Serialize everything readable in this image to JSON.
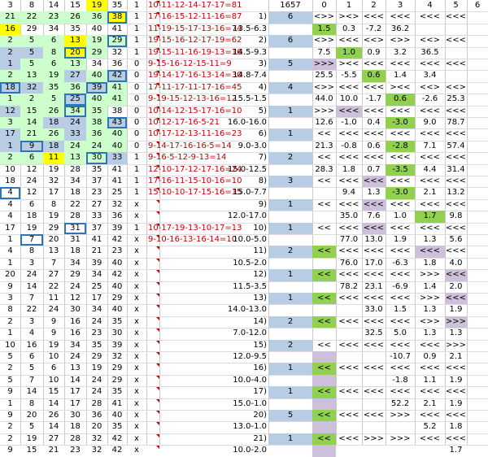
{
  "header": {
    "cols": [
      "3",
      "8",
      "14",
      "15",
      "19",
      "35",
      "1",
      "10-11-12-14-17-17=81",
      "",
      "1657",
      "0",
      "1",
      "2",
      "3",
      "4",
      "5",
      "6"
    ]
  },
  "colors": {
    "green": "#ccffcc",
    "blue": "#b8cce4",
    "yellow": "#ffff00",
    "darkgreen": "#92d050",
    "purple": "#ccc0da",
    "box": "#2e75b6",
    "red": "#c00000"
  },
  "rows": [
    {
      "n": [
        "21",
        "22",
        "23",
        "26",
        "36",
        "38"
      ],
      "d": "1",
      "eq": "17-16-15-12-11-16=87",
      "lbl": "1)",
      "s": "6",
      "r": [
        "<>>",
        "><>",
        "<<<",
        "<<<",
        "<<<",
        "<<<"
      ],
      "bg": [
        "g",
        "g",
        "g",
        "g",
        "g",
        "y"
      ]
    },
    {
      "n": [
        "16",
        "29",
        "34",
        "35",
        "40",
        "41"
      ],
      "d": "1",
      "eq": "11-19-15-17-13-16=74",
      "lbl": "13.5-6.3",
      "s": "",
      "r": [
        "1.5",
        "0.3",
        "-7.2",
        "36.2",
        "",
        ""
      ],
      "bg": [
        "y",
        "",
        "",
        "",
        "",
        ""
      ]
    },
    {
      "n": [
        "2",
        "5",
        "6",
        "13",
        "19",
        "29"
      ],
      "d": "1",
      "eq": "19-15-16-12-17-19=62",
      "lbl": "2)",
      "s": "6",
      "r": [
        "<>>",
        "<<<",
        "<<>",
        "<>>",
        "<<>",
        "<<<"
      ],
      "bg": [
        "g",
        "g",
        "g",
        "y",
        "g",
        "g"
      ]
    },
    {
      "n": [
        "2",
        "5",
        "8",
        "20",
        "29",
        "32"
      ],
      "d": "1",
      "eq": "19-15-11-16-19-13=16",
      "lbl": "14.5-9.3",
      "s": "",
      "r": [
        "7.5",
        "1.0",
        "0.9",
        "3.2",
        "36.5",
        ""
      ],
      "bg": [
        "b",
        "b",
        "g",
        "y",
        "g",
        ""
      ]
    },
    {
      "n": [
        "1",
        "5",
        "6",
        "13",
        "34",
        "36"
      ],
      "d": "0",
      "eq": "9-15-16-12-15-11=9",
      "lbl": "3)",
      "s": "5",
      "r": [
        ">>>",
        "><<",
        "<<<",
        "<<<",
        "<<<",
        "<<<"
      ],
      "bg": [
        "b",
        "g",
        "g",
        "g",
        "",
        ""
      ]
    },
    {
      "n": [
        "2",
        "13",
        "19",
        "27",
        "40",
        "42"
      ],
      "d": "0",
      "eq": "19-14-17-16-13-14=30",
      "lbl": "14.8-7.4",
      "s": "",
      "r": [
        "25.5",
        "-5.5",
        "0.6",
        "1.4",
        "3.4",
        ""
      ],
      "bg": [
        "g",
        "g",
        "g",
        "b",
        "g",
        "b"
      ]
    },
    {
      "n": [
        "18",
        "32",
        "35",
        "36",
        "39",
        "41"
      ],
      "d": "0",
      "eq": "17-11-17-11-17-16=45",
      "lbl": "4)",
      "s": "4",
      "r": [
        "<>>",
        "<<<",
        "<<<",
        "><<",
        "<<>",
        "<<>"
      ],
      "bg": [
        "b",
        "b",
        "g",
        "g",
        "b",
        "g"
      ]
    },
    {
      "n": [
        "1",
        "2",
        "5",
        "25",
        "40",
        "41"
      ],
      "d": "0",
      "eq": "9-19-15-12-13-16=12",
      "lbl": "15.5-1.5",
      "s": "",
      "r": [
        "44.0",
        "10.0",
        "-1.7",
        "0.6",
        "-2.6",
        "25.3"
      ],
      "bg": [
        "g",
        "g",
        "g",
        "b",
        "g",
        "g"
      ]
    },
    {
      "n": [
        "12",
        "15",
        "26",
        "34",
        "35",
        "38"
      ],
      "d": "0",
      "eq": "10-14-12-15-17-16=10",
      "lbl": "5)",
      "s": "1",
      "r": [
        ">>>",
        "<<<",
        "<<<",
        "<<<",
        "<<<",
        "<<<"
      ],
      "bg": [
        "b",
        "g",
        "g",
        "g",
        "g",
        ""
      ]
    },
    {
      "n": [
        "3",
        "14",
        "18",
        "24",
        "38",
        "43"
      ],
      "d": "0",
      "eq": "10-12-17-16-5-21",
      "lbl": "16.0-16.0",
      "s": "",
      "r": [
        "12.6",
        "-1.0",
        "0.4",
        "-3.0",
        "9.0",
        "78.7"
      ],
      "bg": [
        "g",
        "g",
        "b",
        "b",
        "g",
        "b"
      ]
    },
    {
      "n": [
        "17",
        "21",
        "26",
        "33",
        "36",
        "40"
      ],
      "d": "0",
      "eq": "10-17-12-13-11-16=23",
      "lbl": "6)",
      "s": "1",
      "r": [
        "<<",
        "<<<",
        "<<<",
        "<<<",
        "<<<",
        "<<<"
      ],
      "bg": [
        "b",
        "g",
        "g",
        "b",
        "g",
        "g"
      ]
    },
    {
      "n": [
        "1",
        "9",
        "18",
        "24",
        "24",
        "40"
      ],
      "d": "0",
      "eq": "9-14-17-16-16-5=14",
      "lbl": "9.0-3.0",
      "s": "",
      "r": [
        "21.3",
        "-0.8",
        "0.6",
        "-2.8",
        "7.1",
        "57.4"
      ],
      "bg": [
        "b",
        "b",
        "b",
        "g",
        "g",
        "g"
      ]
    },
    {
      "n": [
        "2",
        "6",
        "11",
        "13",
        "30",
        "33"
      ],
      "d": "1",
      "eq": "9-16-5-12-9-13=14",
      "lbl": "7)",
      "s": "2",
      "r": [
        "<<",
        "<<<",
        "<<<",
        "<<<",
        "<<<",
        "<<<"
      ],
      "bg": [
        "g",
        "g",
        "y",
        "g",
        "g",
        "b"
      ]
    },
    {
      "n": [
        "10",
        "12",
        "19",
        "28",
        "35",
        "41"
      ],
      "d": "1",
      "eq": "12-10-17-12-17-16=24",
      "lbl": "15.0-12.5",
      "s": "",
      "r": [
        "28.3",
        "1.8",
        "0.7",
        "-3.5",
        "4.4",
        "31.4"
      ],
      "bg": [
        "",
        "",
        "",
        "",
        "",
        ""
      ]
    },
    {
      "n": [
        "18",
        "24",
        "32",
        "34",
        "37",
        "41"
      ],
      "d": "1",
      "eq": "17-16-11-15-10-16=10",
      "lbl": "8)",
      "s": "3",
      "r": [
        "<<",
        "<<<",
        "<<<",
        "<<<",
        "<<<",
        "<<<"
      ],
      "bg": [
        "",
        "",
        "",
        "",
        "",
        ""
      ]
    },
    {
      "n": [
        "4",
        "12",
        "17",
        "18",
        "23",
        "25"
      ],
      "d": "1",
      "eq": "15-10-10-17-15-16=15",
      "lbl": "15.0-7.7",
      "s": "",
      "r": [
        "",
        "9.4",
        "1.3",
        "-3.0",
        "2.1",
        "13.2"
      ],
      "bg": [
        "",
        "",
        "",
        "",
        "",
        ""
      ]
    },
    {
      "n": [
        "4",
        "6",
        "8",
        "22",
        "27",
        "32"
      ],
      "d": "x",
      "eq": "",
      "lbl": "9)",
      "s": "1",
      "r": [
        "<<",
        "<<<",
        "<<<",
        "<<<",
        "<<<",
        "<<<"
      ],
      "bg": [
        "",
        "",
        "",
        "",
        "",
        ""
      ]
    },
    {
      "n": [
        "4",
        "18",
        "19",
        "28",
        "33",
        "36"
      ],
      "d": "x",
      "eq": "",
      "lbl": "12.0-17.0",
      "s": "",
      "r": [
        "",
        "35.0",
        "7.6",
        "1.0",
        "1.7",
        "9.8"
      ],
      "bg": [
        "",
        "",
        "",
        "",
        "",
        ""
      ]
    },
    {
      "n": [
        "17",
        "19",
        "29",
        "31",
        "37",
        "39"
      ],
      "d": "1",
      "eq": "10-17-19-13-10-17=13",
      "lbl": "10)",
      "s": "1",
      "r": [
        "<<",
        "<<<",
        "<<<",
        "<<<",
        "<<<",
        "<<<"
      ],
      "bg": [
        "",
        "",
        "",
        "",
        "",
        ""
      ]
    },
    {
      "n": [
        "1",
        "7",
        "20",
        "31",
        "41",
        "42"
      ],
      "d": "x",
      "eq": "9-10-16-13-16-14=10",
      "lbl": "10.0-5.0",
      "s": "",
      "r": [
        "",
        "77.0",
        "13.0",
        "1.9",
        "1.3",
        "5.6"
      ],
      "bg": [
        "",
        "",
        "",
        "",
        "",
        ""
      ]
    },
    {
      "n": [
        "4",
        "8",
        "13",
        "18",
        "21",
        "23"
      ],
      "d": "x",
      "eq": "",
      "lbl": "11)",
      "s": "2",
      "r": [
        "<<",
        "<<<",
        "<<<",
        "<<<",
        "<<<",
        "<<<"
      ],
      "bg": [
        "",
        "",
        "",
        "",
        "",
        ""
      ]
    },
    {
      "n": [
        "1",
        "3",
        "7",
        "34",
        "39",
        "40"
      ],
      "d": "x",
      "eq": "",
      "lbl": "10.5-2.0",
      "s": "",
      "r": [
        "",
        "76.0",
        "17.0",
        "-6.3",
        "1.8",
        "4.0"
      ],
      "bg": [
        "",
        "",
        "",
        "",
        "",
        ""
      ]
    },
    {
      "n": [
        "20",
        "24",
        "27",
        "29",
        "34",
        "42"
      ],
      "d": "x",
      "eq": "",
      "lbl": "12)",
      "s": "1",
      "r": [
        "<<",
        "<<<",
        "<<<",
        "<<<",
        ">>>",
        "<<<"
      ],
      "bg": [
        "",
        "",
        "",
        "",
        "",
        ""
      ]
    },
    {
      "n": [
        "9",
        "14",
        "22",
        "24",
        "25",
        "40"
      ],
      "d": "x",
      "eq": "",
      "lbl": "11.5-3.5",
      "s": "",
      "r": [
        "",
        "78.2",
        "23.1",
        "-6.9",
        "1.4",
        "2.0"
      ],
      "bg": [
        "",
        "",
        "",
        "",
        "",
        ""
      ]
    },
    {
      "n": [
        "3",
        "7",
        "11",
        "12",
        "17",
        "29"
      ],
      "d": "x",
      "eq": "",
      "lbl": "13)",
      "s": "1",
      "r": [
        "<<",
        "<<<",
        "<<<",
        "<<<",
        ">>>",
        "<<<"
      ],
      "bg": [
        "",
        "",
        "",
        "",
        "",
        ""
      ]
    },
    {
      "n": [
        "8",
        "22",
        "24",
        "30",
        "34",
        "40"
      ],
      "d": "x",
      "eq": "",
      "lbl": "14.0-13.0",
      "s": "",
      "r": [
        "",
        "",
        "33.0",
        "1.5",
        "1.3",
        "1.9"
      ],
      "bg": [
        "",
        "",
        "",
        "",
        "",
        ""
      ]
    },
    {
      "n": [
        "2",
        "3",
        "9",
        "16",
        "24",
        "35"
      ],
      "d": "x",
      "eq": "",
      "lbl": "14)",
      "s": "2",
      "r": [
        "<<",
        "<<<",
        "<<<",
        "<<<",
        "<>>",
        ">>>"
      ],
      "bg": [
        "",
        "",
        "",
        "",
        "",
        ""
      ]
    },
    {
      "n": [
        "1",
        "4",
        "9",
        "16",
        "23",
        "30"
      ],
      "d": "x",
      "eq": "",
      "lbl": "7.0-12.0",
      "s": "",
      "r": [
        "",
        "",
        "32.5",
        "5.0",
        "1.3",
        "1.3"
      ],
      "bg": [
        "",
        "",
        "",
        "",
        "",
        ""
      ]
    },
    {
      "n": [
        "10",
        "16",
        "19",
        "34",
        "35",
        "39"
      ],
      "d": "x",
      "eq": "",
      "lbl": "15)",
      "s": "2",
      "r": [
        "<<",
        "<<<",
        "<<<",
        "<<<",
        "<<<",
        ">>>"
      ],
      "bg": [
        "",
        "",
        "",
        "",
        "",
        ""
      ]
    },
    {
      "n": [
        "5",
        "6",
        "10",
        "24",
        "29",
        "32"
      ],
      "d": "x",
      "eq": "",
      "lbl": "12.0-9.5",
      "s": "",
      "r": [
        "",
        "",
        "",
        "-10.7",
        "0.9",
        "2.1"
      ],
      "bg": [
        "",
        "",
        "",
        "",
        "",
        ""
      ]
    },
    {
      "n": [
        "2",
        "5",
        "6",
        "13",
        "19",
        "29"
      ],
      "d": "x",
      "eq": "",
      "lbl": "16)",
      "s": "1",
      "r": [
        "<<",
        "<<<",
        "<<<",
        "<<<",
        "<<<",
        "<<<"
      ],
      "bg": [
        "",
        "",
        "",
        "",
        "",
        ""
      ]
    },
    {
      "n": [
        "5",
        "7",
        "10",
        "14",
        "24",
        "29"
      ],
      "d": "x",
      "eq": "",
      "lbl": "10.0-4.0",
      "s": "",
      "r": [
        "",
        "",
        "",
        "-1.8",
        "1.1",
        "1.9"
      ],
      "bg": [
        "",
        "",
        "",
        "",
        "",
        ""
      ]
    },
    {
      "n": [
        "9",
        "14",
        "15",
        "17",
        "24",
        "35"
      ],
      "d": "x",
      "eq": "",
      "lbl": "17)",
      "s": "1",
      "r": [
        "<<",
        "<<<",
        "<<<",
        "<<<",
        "<<<",
        "<<<"
      ],
      "bg": [
        "",
        "",
        "",
        "",
        "",
        ""
      ]
    },
    {
      "n": [
        "1",
        "8",
        "14",
        "17",
        "28",
        "41"
      ],
      "d": "x",
      "eq": "",
      "lbl": "15.0-1.0",
      "s": "",
      "r": [
        "",
        "",
        "",
        "52.2",
        "2.1",
        "1.9"
      ],
      "bg": [
        "",
        "",
        "",
        "",
        "",
        ""
      ]
    },
    {
      "n": [
        "9",
        "20",
        "26",
        "30",
        "36",
        "40"
      ],
      "d": "x",
      "eq": "",
      "lbl": "20)",
      "s": "5",
      "r": [
        "<<",
        "<<<",
        "<<<",
        ">>>",
        "<<<",
        "<<<"
      ],
      "bg": [
        "",
        "",
        "",
        "",
        "",
        ""
      ]
    },
    {
      "n": [
        "2",
        "5",
        "14",
        "18",
        "20",
        "35"
      ],
      "d": "x",
      "eq": "",
      "lbl": "13.0-1.0",
      "s": "",
      "r": [
        "",
        "",
        "",
        "",
        "5.2",
        "1.8"
      ],
      "bg": [
        "",
        "",
        "",
        "",
        "",
        ""
      ]
    },
    {
      "n": [
        "2",
        "19",
        "27",
        "28",
        "32",
        "42"
      ],
      "d": "x",
      "eq": "",
      "lbl": "21)",
      "s": "1",
      "r": [
        "<<",
        "<<<",
        ">>>",
        ">>>",
        "<<<",
        "<<<"
      ],
      "bg": [
        "",
        "",
        "",
        "",
        "",
        ""
      ]
    },
    {
      "n": [
        "9",
        "15",
        "21",
        "23",
        "32",
        "42"
      ],
      "d": "x",
      "eq": "",
      "lbl": "10.0-2.0",
      "s": "",
      "r": [
        "",
        "",
        "",
        "",
        "",
        "1.7"
      ],
      "bg": [
        "",
        "",
        "",
        "",
        "",
        ""
      ]
    }
  ]
}
